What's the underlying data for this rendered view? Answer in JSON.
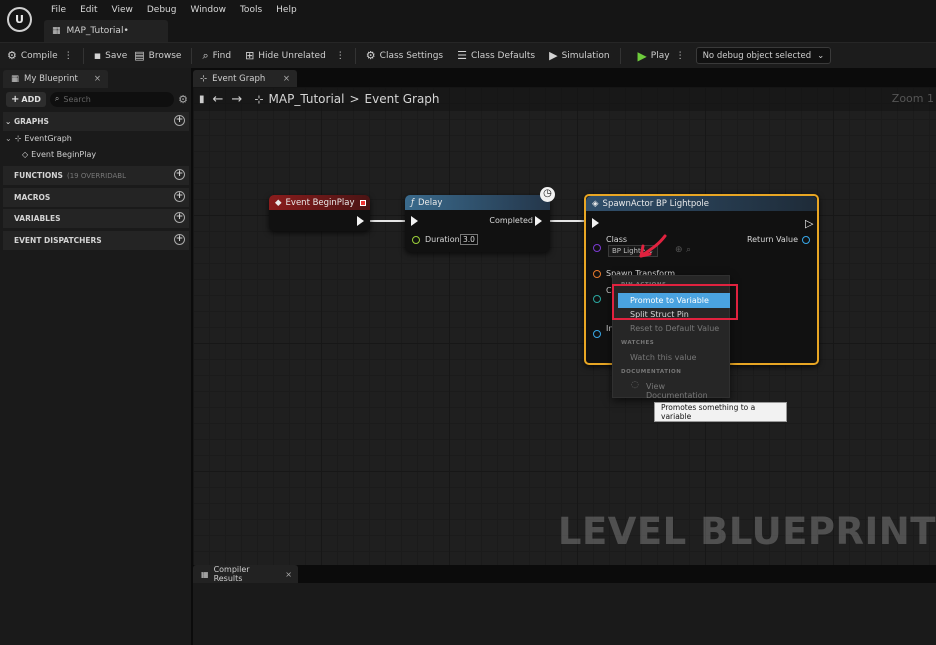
{
  "app": {
    "logo_text": "U",
    "menu": [
      "File",
      "Edit",
      "View",
      "Debug",
      "Window",
      "Tools",
      "Help"
    ],
    "document_tab": "MAP_Tutorial•"
  },
  "toolbar": {
    "compile": "Compile",
    "save": "Save",
    "browse": "Browse",
    "find": "Find",
    "hide_unrelated": "Hide Unrelated",
    "class_settings": "Class Settings",
    "class_defaults": "Class Defaults",
    "simulation": "Simulation",
    "play": "Play",
    "debug_object": "No debug object selected"
  },
  "my_blueprint": {
    "tab": "My Blueprint",
    "add": "ADD",
    "search_placeholder": "Search",
    "sections": {
      "graphs": "GRAPHS",
      "functions": "FUNCTIONS",
      "functions_sub": "(19 OVERRIDABL",
      "macros": "MACROS",
      "variables": "VARIABLES",
      "event_dispatchers": "EVENT DISPATCHERS"
    },
    "graph_tree": {
      "event_graph": "EventGraph",
      "event_begin_play": "Event BeginPlay"
    }
  },
  "graph": {
    "tab": "Event Graph",
    "breadcrumb_root": "MAP_Tutorial",
    "breadcrumb_sep": ">",
    "breadcrumb_leaf": "Event Graph",
    "zoom": "Zoom 1",
    "watermark": "LEVEL BLUEPRINT",
    "nodes": {
      "begin_play": {
        "title": "Event BeginPlay"
      },
      "delay": {
        "title": "Delay",
        "completed": "Completed",
        "duration_label": "Duration",
        "duration_value": "3.0"
      },
      "spawn": {
        "title": "SpawnActor BP Lightpole",
        "class_label": "Class",
        "class_value": "BP Lighte",
        "return_value": "Return Value",
        "spawn_transform": "Spawn Transform",
        "collision_partial": "Co",
        "instigator_partial": "In"
      }
    }
  },
  "context_menu": {
    "pin_actions": "PIN ACTIONS",
    "promote": "Promote to Variable",
    "split": "Split Struct Pin",
    "reset": "Reset to Default Value",
    "watches": "WATCHES",
    "watch": "Watch this value",
    "documentation": "DOCUMENTATION",
    "view_docs": "View Documentation"
  },
  "tooltip": "Promotes something to a variable",
  "bottom": {
    "compiler_tab": "Compiler Results"
  },
  "colors": {
    "begin_play_header": "#7a1a1a",
    "delay_header": "#2c4a62",
    "spawn_header": "#2a3b4e",
    "spawn_outline": "#e8a624",
    "highlight": "#4aa3e0",
    "annotation_red": "#e0223f"
  }
}
